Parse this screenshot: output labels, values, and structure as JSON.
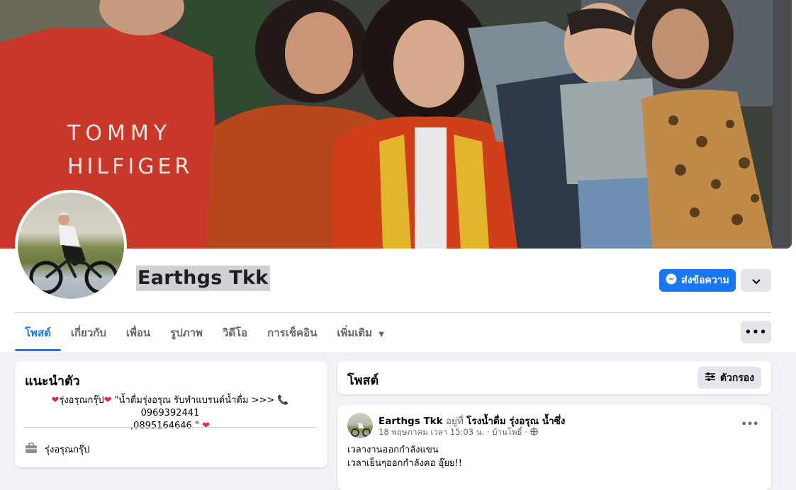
{
  "profile": {
    "name": "Earthgs Tkk",
    "message_button": "ส่งข้อความ",
    "cover_text_line1": "TOMMY",
    "cover_text_line2": "HILFIGER"
  },
  "tabs": [
    {
      "label": "โพสต์",
      "active": true
    },
    {
      "label": "เกี่ยวกับ"
    },
    {
      "label": "เพื่อน"
    },
    {
      "label": "รูปภาพ"
    },
    {
      "label": "วิดีโอ"
    },
    {
      "label": "การเช็คอิน"
    },
    {
      "label": "เพิ่มเติม",
      "has_dropdown": true
    }
  ],
  "intro": {
    "title": "แนะนำตัว",
    "bio_line1_a": "รุ่งอรุณกรุ๊ป",
    "bio_line1_b": "\"น้ำดื่มรุ่งอรุณ รับทำแบรนด์น้ำดื่ม >>>",
    "bio_line1_phone": "0969392441",
    "bio_line2": ",0895164646 \"",
    "work": "รุ่งอรุณกรุ๊ป"
  },
  "posts_header": {
    "title": "โพสต์",
    "filter_button": "ตัวกรอง"
  },
  "post": {
    "author": "Earthgs Tkk",
    "at_word": "อยู่ที่",
    "place": "โรงน้ำดื่ม รุ่งอรุณ น้ำซึ่ง",
    "meta": "18 พฤษภาคม เวลา 15:03 น. · บ้านโพธิ์ ·",
    "line1": "เวลางานออกกำลังแขน",
    "line2": "เวลาเย็นๆออกกำลังคอ อุ๊ยย!!"
  },
  "colors": {
    "accent": "#1877f2",
    "page_bg": "#f0f2f5",
    "heart": "#e0245e"
  }
}
